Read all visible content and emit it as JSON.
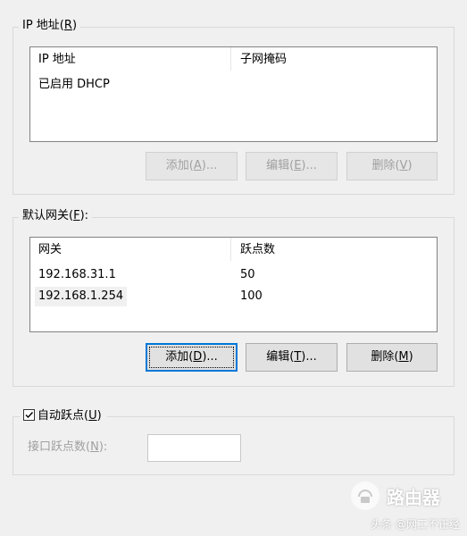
{
  "ip_group": {
    "legend_text": "IP 地址(",
    "legend_key": "R",
    "legend_end": ")",
    "columns": [
      "IP 地址",
      "子网掩码"
    ],
    "rows": [
      [
        "已启用 DHCP",
        ""
      ]
    ],
    "buttons": [
      {
        "text": "添加(",
        "key": "A",
        "end": ")..."
      },
      {
        "text": "编辑(",
        "key": "E",
        "end": ")..."
      },
      {
        "text": "删除(",
        "key": "V",
        "end": ")"
      }
    ]
  },
  "gateway_group": {
    "legend_text": "默认网关(",
    "legend_key": "F",
    "legend_end": "):",
    "columns": [
      "网关",
      "跃点数"
    ],
    "rows": [
      [
        "192.168.31.1",
        "50"
      ],
      [
        "192.168.1.254",
        "100"
      ]
    ],
    "buttons": [
      {
        "text": "添加(",
        "key": "D",
        "end": ")..."
      },
      {
        "text": "编辑(",
        "key": "T",
        "end": ")..."
      },
      {
        "text": "删除(",
        "key": "M",
        "end": ")"
      }
    ]
  },
  "metric_group": {
    "checkbox_text": "自动跃点(",
    "checkbox_key": "U",
    "checkbox_end": ")",
    "checked": true,
    "field_text": "接口跃点数(",
    "field_key": "N",
    "field_end": "):",
    "field_value": ""
  },
  "watermark": {
    "logo_text": "路由器",
    "caption": "头条 @网工不正经"
  }
}
